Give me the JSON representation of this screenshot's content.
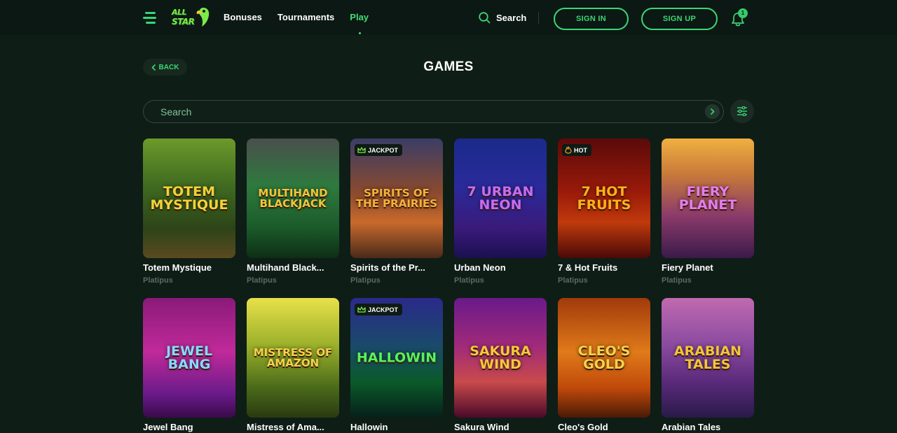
{
  "header": {
    "logo_line1": "ALL",
    "logo_line2": "STAR",
    "nav": [
      {
        "label": "Bonuses",
        "active": false
      },
      {
        "label": "Tournaments",
        "active": false
      },
      {
        "label": "Play",
        "active": true
      }
    ],
    "search_label": "Search",
    "sign_in": "SIGN IN",
    "sign_up": "SIGN UP",
    "notification_count": "1"
  },
  "page": {
    "back_label": "BACK",
    "title": "GAMES",
    "search_placeholder": "Search"
  },
  "games": [
    {
      "name": "Totem Mystique",
      "provider": "Platipus",
      "art": "TOTEM MYSTIQUE",
      "tag": "",
      "bg": "linear-gradient(180deg,#6c9a2a 0%,#3f6a20 40%,#2d4418 75%,#5a4a1f 100%)",
      "art_color": "#f4d23a"
    },
    {
      "name": "Multihand Black...",
      "provider": "Platipus",
      "art": "MULTIHAND BLACKJACK",
      "tag": "",
      "bg": "linear-gradient(180deg,#4a4f4c 0%,#2e7a3e 40%,#1b5a2a 75%,#0d2e15 100%)",
      "art_color": "#f0c63a"
    },
    {
      "name": "Spirits of the Pr...",
      "provider": "Platipus",
      "art": "SPIRITS OF THE PRAIRIES",
      "tag": "JACKPOT",
      "bg": "linear-gradient(180deg,#3a3d66 0%,#8a4a2e 45%,#c86a2c 70%,#4a2a1a 100%)",
      "art_color": "#f6b13a"
    },
    {
      "name": "Urban Neon",
      "provider": "Platipus",
      "art": "7 URBAN NEON",
      "tag": "",
      "bg": "linear-gradient(180deg,#1a2a8a 0%,#2a2a9a 40%,#3a1a7a 75%,#1a1050 100%)",
      "art_color": "#c86cf2"
    },
    {
      "name": "7 & Hot Fruits",
      "provider": "Platipus",
      "art": "7 HOT FRUITS",
      "tag": "HOT",
      "bg": "linear-gradient(180deg,#5a0a0a 0%,#9a1a0a 45%,#c03a0c 70%,#4a0a06 100%)",
      "art_color": "#ffb01a"
    },
    {
      "name": "Fiery Planet",
      "provider": "Platipus",
      "art": "FIERY PLANET",
      "tag": "",
      "bg": "linear-gradient(180deg,#f0b040 0%,#c87a3a 30%,#8a3a6a 65%,#3a1a4a 100%)",
      "art_color": "#e57cf0"
    },
    {
      "name": "Jewel Bang",
      "provider": "",
      "art": "JEWEL BANG",
      "tag": "",
      "bg": "linear-gradient(180deg,#8a1a7a 0%,#c02a9a 45%,#6a1a8a 80%,#3a0a4a 100%)",
      "art_color": "#8ad8ff"
    },
    {
      "name": "Mistress of Ama...",
      "provider": "",
      "art": "MISTRESS OF AMAZON",
      "tag": "",
      "bg": "linear-gradient(180deg,#e8e04a 0%,#9ab02a 40%,#4a6a1a 75%,#2a3a10 100%)",
      "art_color": "#f6d24a"
    },
    {
      "name": "Hallowin",
      "provider": "",
      "art": "HALLOWIN",
      "tag": "JACKPOT",
      "bg": "linear-gradient(180deg,#2a2a8a 0%,#1a4a6a 40%,#0a5a2a 70%,#06201a 100%)",
      "art_color": "#5cf05a"
    },
    {
      "name": "Sakura Wind",
      "provider": "",
      "art": "SAKURA WIND",
      "tag": "",
      "bg": "linear-gradient(180deg,#6a1a8a 0%,#a02a7a 40%,#c84a4a 70%,#4a0a2a 100%)",
      "art_color": "#f6c83a"
    },
    {
      "name": "Cleo's Gold",
      "provider": "",
      "art": "CLEO'S GOLD",
      "tag": "",
      "bg": "linear-gradient(180deg,#a03a0a 0%,#e07a1a 45%,#c04a0a 75%,#4a1a06 100%)",
      "art_color": "#f6d24a"
    },
    {
      "name": "Arabian Tales",
      "provider": "",
      "art": "ARABIAN TALES",
      "tag": "",
      "bg": "linear-gradient(180deg,#c06ab0 0%,#8a4aa0 40%,#5a2a7a 70%,#2a1a4a 100%)",
      "art_color": "#f4c43a"
    }
  ]
}
